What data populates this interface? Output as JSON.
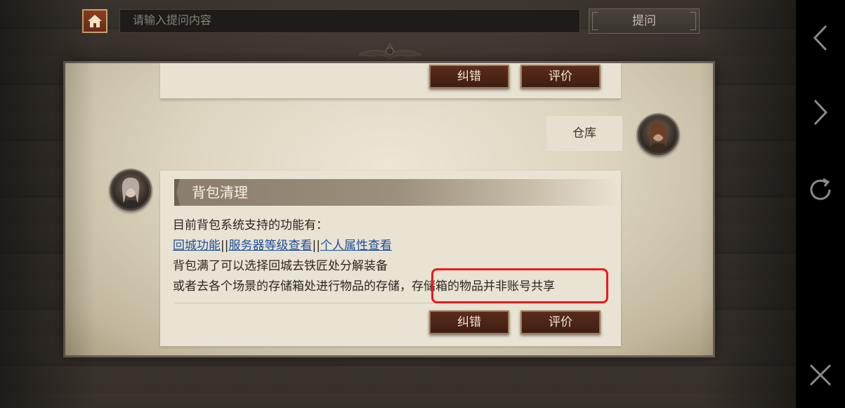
{
  "header": {
    "search_placeholder": "请输入提问内容",
    "ask_label": "提问"
  },
  "previous_card": {
    "correct_label": "纠错",
    "rate_label": "评价"
  },
  "user_message": "仓库",
  "answer_card": {
    "title": "背包清理",
    "line1": "目前背包系统支持的功能有：",
    "links": [
      "回城功能",
      "服务器等级查看",
      "个人属性查看"
    ],
    "separator": "||",
    "line3": "背包满了可以选择回城去铁匠处分解装备",
    "line4a": "或者去各个场景的存储箱处进行物品的存储，",
    "line4b": "存储箱的物品并非账号共享",
    "correct_label": "纠错",
    "rate_label": "评价"
  },
  "colors": {
    "highlight_border": "#f01818",
    "link": "#1e4f9a",
    "button_bg": "#4a2416"
  },
  "icons": {
    "home": "home-icon",
    "back": "chevron-left-icon",
    "forward": "chevron-right-icon",
    "refresh": "refresh-icon",
    "close": "close-icon"
  }
}
